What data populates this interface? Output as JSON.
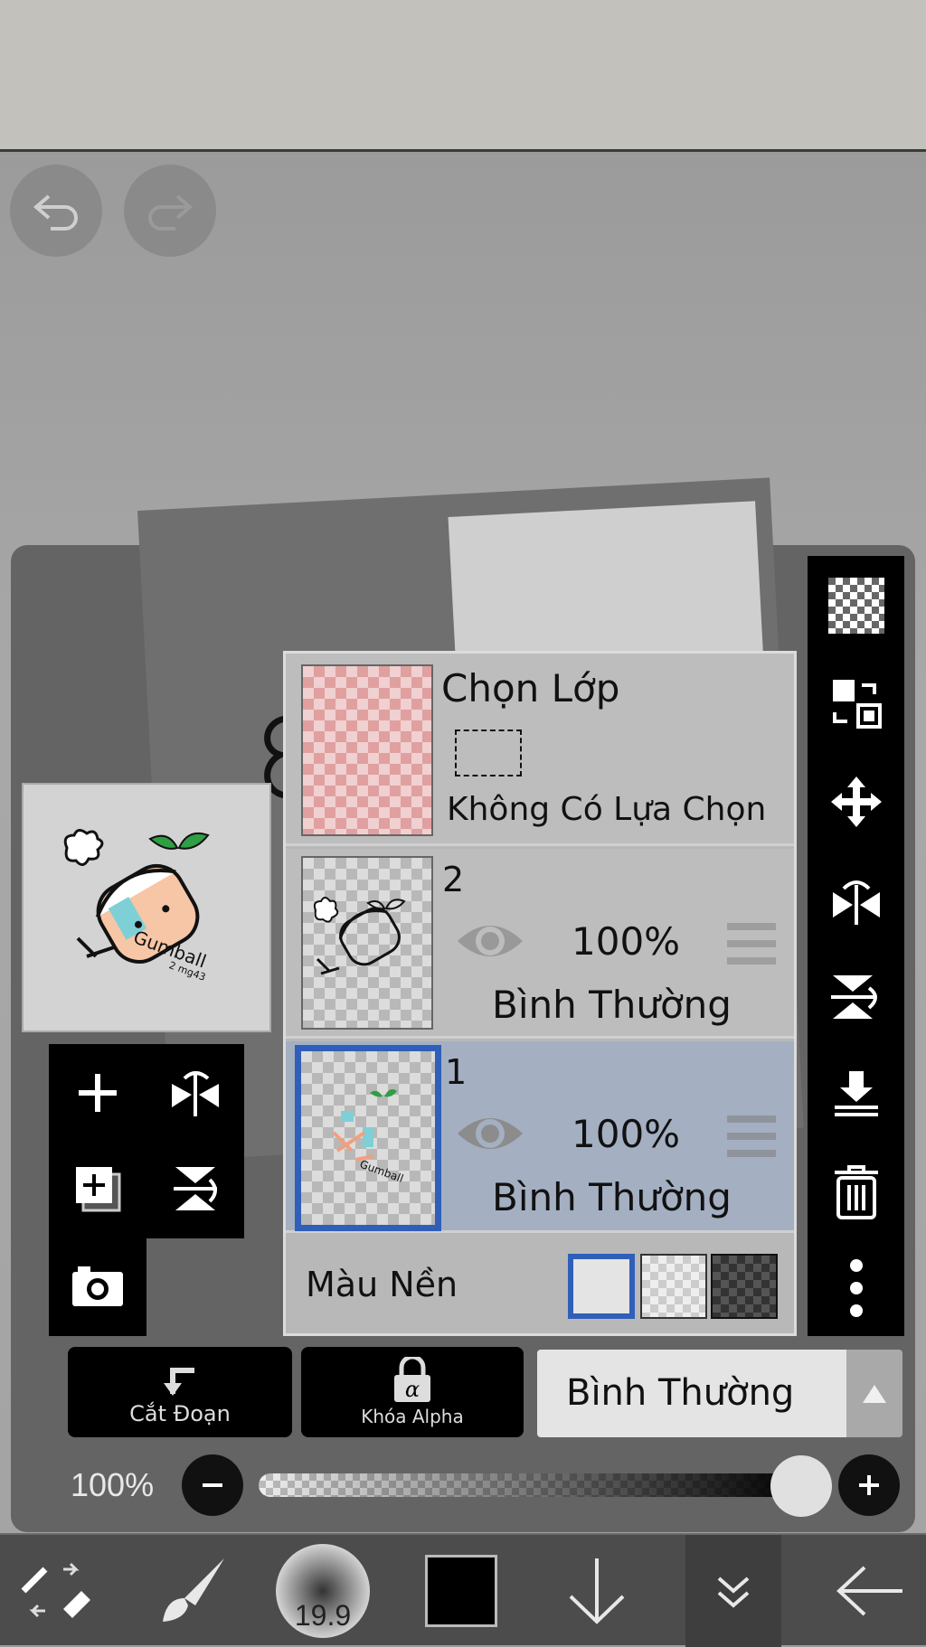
{
  "layer_panel": {
    "selection_layer": {
      "title": "Chọn Lớp",
      "status": "Không Có Lựa Chọn"
    },
    "layers": [
      {
        "number": "2",
        "opacity": "100%",
        "blend": "Bình Thường",
        "selected": false
      },
      {
        "number": "1",
        "opacity": "100%",
        "blend": "Bình Thường",
        "selected": true
      }
    ],
    "background_label": "Màu Nền"
  },
  "bottom_controls": {
    "clipping_label": "Cắt Đoạn",
    "alpha_lock_label": "Khóa Alpha",
    "blend_mode": "Bình Thường",
    "opacity_label": "100%",
    "opacity_value": 100
  },
  "toolbar": {
    "brush_size": "19.9",
    "current_color": "#000000"
  },
  "preview_text": {
    "signature": "Gumball",
    "sub": "2 mg43"
  },
  "colors": {
    "accent": "#2f5fb8",
    "selected_row": "#a4afc2",
    "leaf": "#2f9e44",
    "cheek": "#f5b08a",
    "cyan": "#7fd0d6"
  }
}
